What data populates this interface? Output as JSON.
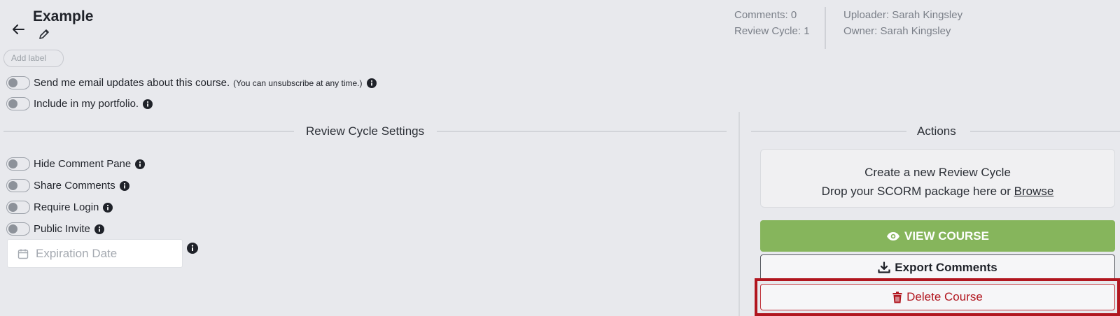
{
  "header": {
    "title": "Example",
    "add_label_placeholder": "Add label"
  },
  "meta": {
    "comments": "Comments: 0",
    "review_cycle": "Review Cycle: 1",
    "uploader": "Uploader: Sarah Kingsley",
    "owner": "Owner: Sarah Kingsley"
  },
  "preferences": {
    "email_updates": "Send me email updates about this course.",
    "email_note": "(You can unsubscribe at any time.)",
    "portfolio": "Include in my portfolio."
  },
  "review_settings": {
    "title": "Review Cycle Settings",
    "toggles": [
      {
        "label": "Hide Comment Pane",
        "on": false
      },
      {
        "label": "Share Comments",
        "on": false
      },
      {
        "label": "Require Login",
        "on": false
      },
      {
        "label": "Public Invite",
        "on": false
      }
    ],
    "expiration_placeholder": "Expiration Date"
  },
  "actions": {
    "title": "Actions",
    "drop_line1": "Create a new Review Cycle",
    "drop_line2": "Drop your SCORM package here or",
    "browse": "Browse",
    "view_course": "VIEW COURSE",
    "export_comments": "Export Comments",
    "delete_course": "Delete Course"
  },
  "colors": {
    "view_button": "#86b55c",
    "delete_red": "#b1161f",
    "background": "#e8e9ed"
  }
}
